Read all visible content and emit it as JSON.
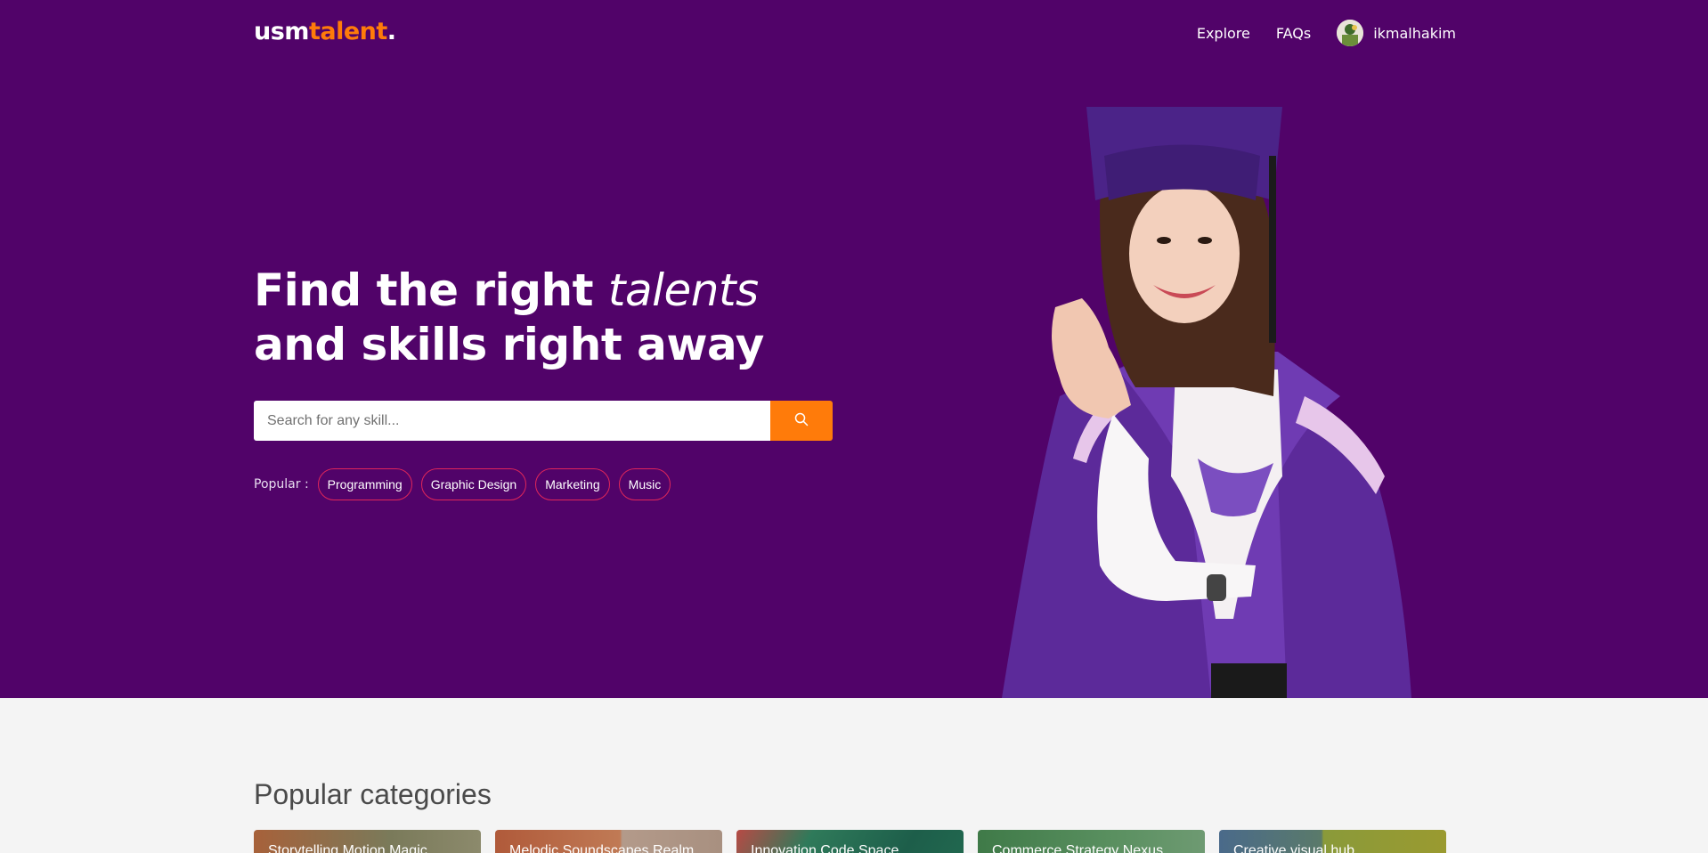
{
  "header": {
    "logo": {
      "part1": "usm",
      "part2": "talent",
      "part3": "."
    },
    "nav": {
      "explore": "Explore",
      "faqs": "FAQs"
    },
    "user": {
      "name": "ikmalhakim"
    }
  },
  "hero": {
    "headline_part1": "Find the right ",
    "headline_italic": "talents",
    "headline_line2": "and skills right away",
    "search": {
      "placeholder": "Search for any skill...",
      "button_icon": "search-icon"
    },
    "popular_label": "Popular :",
    "popular_tags": [
      "Programming",
      "Graphic Design",
      "Marketing",
      "Music"
    ]
  },
  "categories": {
    "title": "Popular categories",
    "items": [
      {
        "title": "Storytelling Motion Magic"
      },
      {
        "title": "Melodic Soundscapes Realm"
      },
      {
        "title": "Innovation Code Space"
      },
      {
        "title": "Commerce Strategy Nexus"
      },
      {
        "title": "Creative visual hub"
      }
    ]
  },
  "colors": {
    "hero_bg": "#510369",
    "accent": "#ff7b0a",
    "tag_border": "#e0265a"
  }
}
